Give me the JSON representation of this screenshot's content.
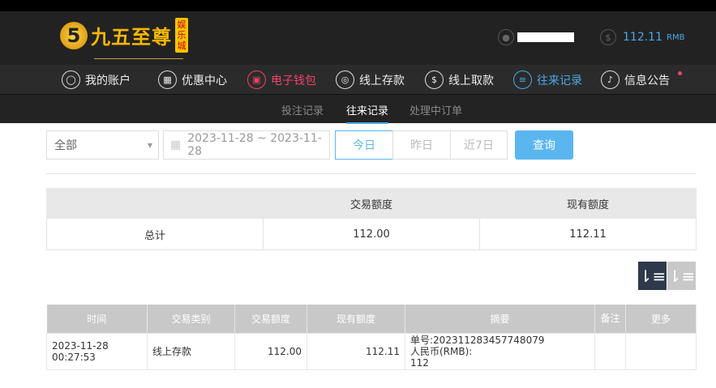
{
  "header": {
    "logo_text": "九五至尊",
    "logo_tag": "娱乐城",
    "balance": "112.11",
    "currency": "RMB"
  },
  "nav": [
    {
      "label": "我的账户",
      "icon": "user-icon"
    },
    {
      "label": "优惠中心",
      "icon": "gift-icon"
    },
    {
      "label": "电子钱包",
      "icon": "wallet-icon"
    },
    {
      "label": "线上存款",
      "icon": "deposit-icon"
    },
    {
      "label": "线上取款",
      "icon": "withdraw-icon"
    },
    {
      "label": "往来记录",
      "icon": "record-icon"
    },
    {
      "label": "信息公告",
      "icon": "bell-icon"
    }
  ],
  "subnav": [
    "投注记录",
    "往来记录",
    "处理中订单"
  ],
  "filter": {
    "type": "全部",
    "date_range": "2023-11-28 ~ 2023-11-28",
    "today": "今日",
    "yesterday": "昨日",
    "last7": "近7日",
    "query": "查询"
  },
  "summary": {
    "headers": [
      "",
      "交易额度",
      "现有额度"
    ],
    "row": [
      "总计",
      "112.00",
      "112.11"
    ]
  },
  "records": {
    "headers": [
      "时间",
      "交易类别",
      "交易额度",
      "现有额度",
      "摘要",
      "备注",
      "更多"
    ],
    "rows": [
      {
        "time": "2023-11-28 00:27:53",
        "type": "线上存款",
        "amount": "112.00",
        "balance": "112.11",
        "summary_line1": "单号:202311283457748079",
        "summary_line2": "人民币(RMB):",
        "summary_line3": "112",
        "note": "",
        "more": ""
      }
    ]
  }
}
